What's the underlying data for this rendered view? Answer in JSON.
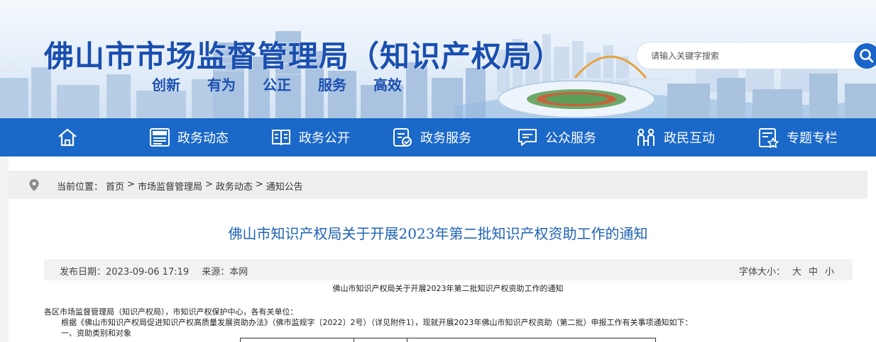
{
  "header": {
    "title": "佛山市市场监督管理局（知识产权局）",
    "slogans": [
      "创新",
      "有为",
      "公正",
      "服务",
      "高效"
    ],
    "search": {
      "placeholder": "请输入关键字搜索"
    }
  },
  "nav": {
    "items": [
      {
        "label": "",
        "icon": "home-icon"
      },
      {
        "label": "政务动态",
        "icon": "news-icon"
      },
      {
        "label": "政务公开",
        "icon": "book-icon"
      },
      {
        "label": "政务服务",
        "icon": "service-icon"
      },
      {
        "label": "公众服务",
        "icon": "chat-icon"
      },
      {
        "label": "政民互动",
        "icon": "people-icon"
      },
      {
        "label": "专题专栏",
        "icon": "topic-icon"
      }
    ]
  },
  "breadcrumb": {
    "prefix": "当前位置：",
    "items": [
      "首页",
      "市场监督管理局",
      "政务动态",
      "通知公告"
    ],
    "separator": ">"
  },
  "article": {
    "title": "佛山市知识产权局关于开展2023年第二批知识产权资助工作的通知",
    "meta": {
      "date": "发布日期：2023-09-06 17:19",
      "source": "来源：本网",
      "font_size_label": "字体大小：",
      "font_sizes": [
        "大",
        "中",
        "小"
      ]
    },
    "doc_title": "佛山市知识产权局关于开展2023年第二批知识产权资助工作的通知",
    "paragraphs": [
      "各区市场监督管理局（知识产权局），市知识产权保护中心，各有关单位：",
      "根据《佛山市知识产权局促进知识产权高质量发展资助办法》（佛市监规字〔2022〕2号）（详见附件1），现就开展2023年佛山市知识产权资助（第二批）申报工作有关事项通知如下：",
      "一、资助类别和对象"
    ]
  },
  "colors": {
    "brand_blue": "#1a68c8",
    "title_blue": "#1a4fb0",
    "article_title_blue": "#1e63b6"
  }
}
